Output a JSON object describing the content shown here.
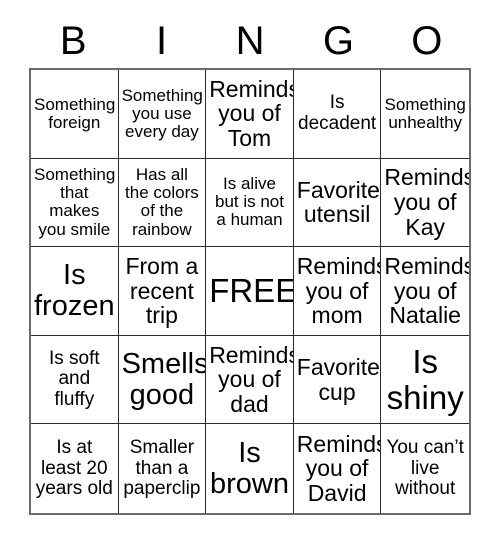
{
  "header": {
    "letters": [
      "B",
      "I",
      "N",
      "G",
      "O"
    ]
  },
  "grid": {
    "rows": 5,
    "columns": 5,
    "border_color": "#6b6b6b",
    "cell_border_color": "#2b2b2b",
    "background": "#ffffff",
    "text_color": "#000000",
    "cells": [
      {
        "text": "Something\nforeign",
        "size": "sm",
        "free": false
      },
      {
        "text": "Something\nyou use\nevery day",
        "size": "sm",
        "free": false
      },
      {
        "text": "Reminds\nyou of\nTom",
        "size": "lg",
        "free": false
      },
      {
        "text": "Is\ndecadent",
        "size": "md",
        "free": false
      },
      {
        "text": "Something\nunhealthy",
        "size": "sm",
        "free": false
      },
      {
        "text": "Something\nthat\nmakes\nyou smile",
        "size": "sm",
        "free": false
      },
      {
        "text": "Has all\nthe colors\nof the\nrainbow",
        "size": "sm",
        "free": false
      },
      {
        "text": "Is alive\nbut is not\na human",
        "size": "sm",
        "free": false
      },
      {
        "text": "Favorite\nutensil",
        "size": "lg",
        "free": false
      },
      {
        "text": "Reminds\nyou of\nKay",
        "size": "lg",
        "free": false
      },
      {
        "text": "Is\nfrozen",
        "size": "xl",
        "free": false
      },
      {
        "text": "From a\nrecent\ntrip",
        "size": "lg",
        "free": false
      },
      {
        "text": "FREE",
        "size": "xxl",
        "free": true
      },
      {
        "text": "Reminds\nyou of\nmom",
        "size": "lg",
        "free": false
      },
      {
        "text": "Reminds\nyou of\nNatalie",
        "size": "lg",
        "free": false
      },
      {
        "text": "Is soft\nand\nfluffy",
        "size": "md",
        "free": false
      },
      {
        "text": "Smells\ngood",
        "size": "xl",
        "free": false
      },
      {
        "text": "Reminds\nyou of\ndad",
        "size": "lg",
        "free": false
      },
      {
        "text": "Favorite\ncup",
        "size": "lg",
        "free": false
      },
      {
        "text": "Is\nshiny",
        "size": "xxl",
        "free": false
      },
      {
        "text": "Is at\nleast 20\nyears old",
        "size": "md",
        "free": false
      },
      {
        "text": "Smaller\nthan a\npaperclip",
        "size": "md",
        "free": false
      },
      {
        "text": "Is\nbrown",
        "size": "xl",
        "free": false
      },
      {
        "text": "Reminds\nyou of\nDavid",
        "size": "lg",
        "free": false
      },
      {
        "text": "You can’t\nlive\nwithout",
        "size": "md",
        "free": false
      }
    ]
  }
}
